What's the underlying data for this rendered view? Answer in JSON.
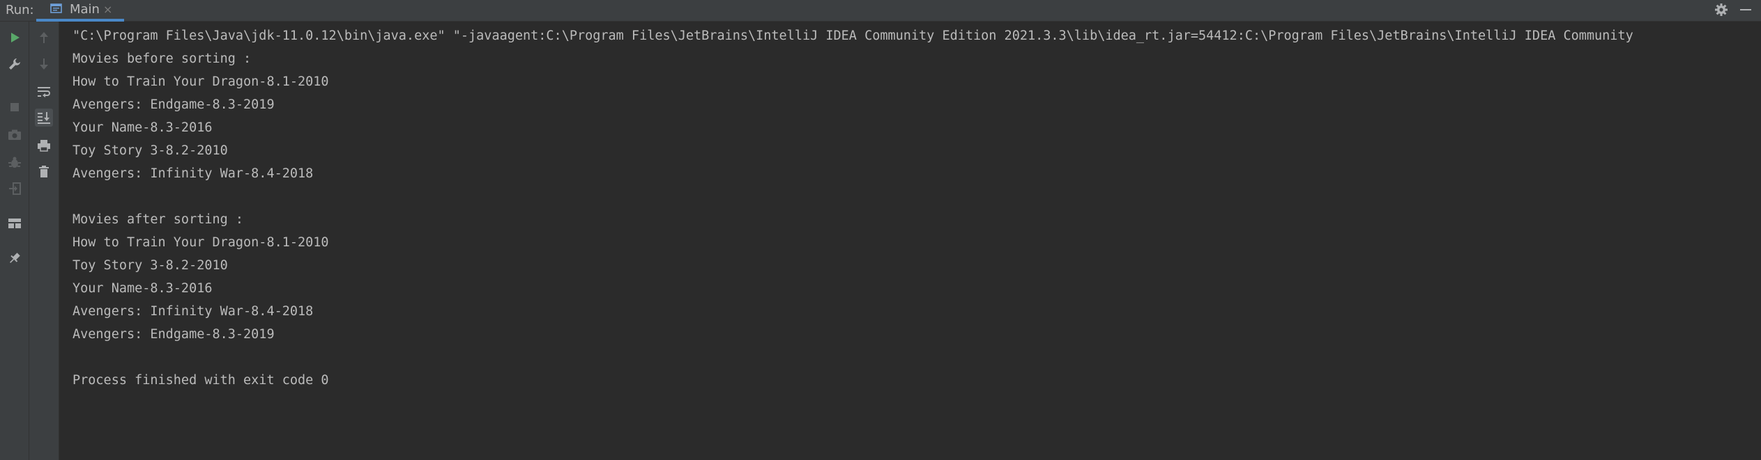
{
  "titlebar": {
    "run_label": "Run:",
    "tab": {
      "label": "Main",
      "close": "×",
      "icon": "run-config-icon"
    },
    "settings_icon": "gear-icon",
    "minimize_icon": "minimize-icon"
  },
  "toolbar": {
    "items": [
      {
        "name": "rerun-icon",
        "color": "#59a869"
      },
      {
        "name": "up-arrow-icon",
        "color": "#5c5f61"
      },
      {
        "name": "wrench-icon",
        "color": "#afb1b3"
      },
      {
        "name": "down-arrow-icon",
        "color": "#5c5f61"
      },
      {
        "name": "soft-wrap-icon",
        "color": "#afb1b3"
      },
      {
        "name": "stop-icon",
        "color": "#5c5f61"
      },
      {
        "name": "scroll-to-end-icon",
        "color": "#afb1b3"
      },
      {
        "name": "camera-icon",
        "color": "#5c5f61"
      },
      {
        "name": "print-icon",
        "color": "#afb1b3"
      },
      {
        "name": "debug-icon",
        "color": "#5c5f61"
      },
      {
        "name": "trash-icon",
        "color": "#afb1b3"
      },
      {
        "name": "exit-icon",
        "color": "#5c5f61"
      },
      {
        "name": "layout-icon",
        "color": "#afb1b3"
      },
      {
        "name": "pin-icon",
        "color": "#afb1b3"
      }
    ]
  },
  "console": {
    "lines": [
      "\"C:\\Program Files\\Java\\jdk-11.0.12\\bin\\java.exe\" \"-javaagent:C:\\Program Files\\JetBrains\\IntelliJ IDEA Community Edition 2021.3.3\\lib\\idea_rt.jar=54412:C:\\Program Files\\JetBrains\\IntelliJ IDEA Community",
      "Movies before sorting :",
      "How to Train Your Dragon-8.1-2010",
      "Avengers: Endgame-8.3-2019",
      "Your Name-8.3-2016",
      "Toy Story 3-8.2-2010",
      "Avengers: Infinity War-8.4-2018",
      "",
      "Movies after sorting :",
      "How to Train Your Dragon-8.1-2010",
      "Toy Story 3-8.2-2010",
      "Your Name-8.3-2016",
      "Avengers: Infinity War-8.4-2018",
      "Avengers: Endgame-8.3-2019",
      "",
      "Process finished with exit code 0"
    ]
  },
  "colors": {
    "background": "#2b2b2b",
    "panel": "#3c3f41",
    "text": "#bbbbbb",
    "accent": "#4a88c7",
    "run_green": "#59a869"
  }
}
